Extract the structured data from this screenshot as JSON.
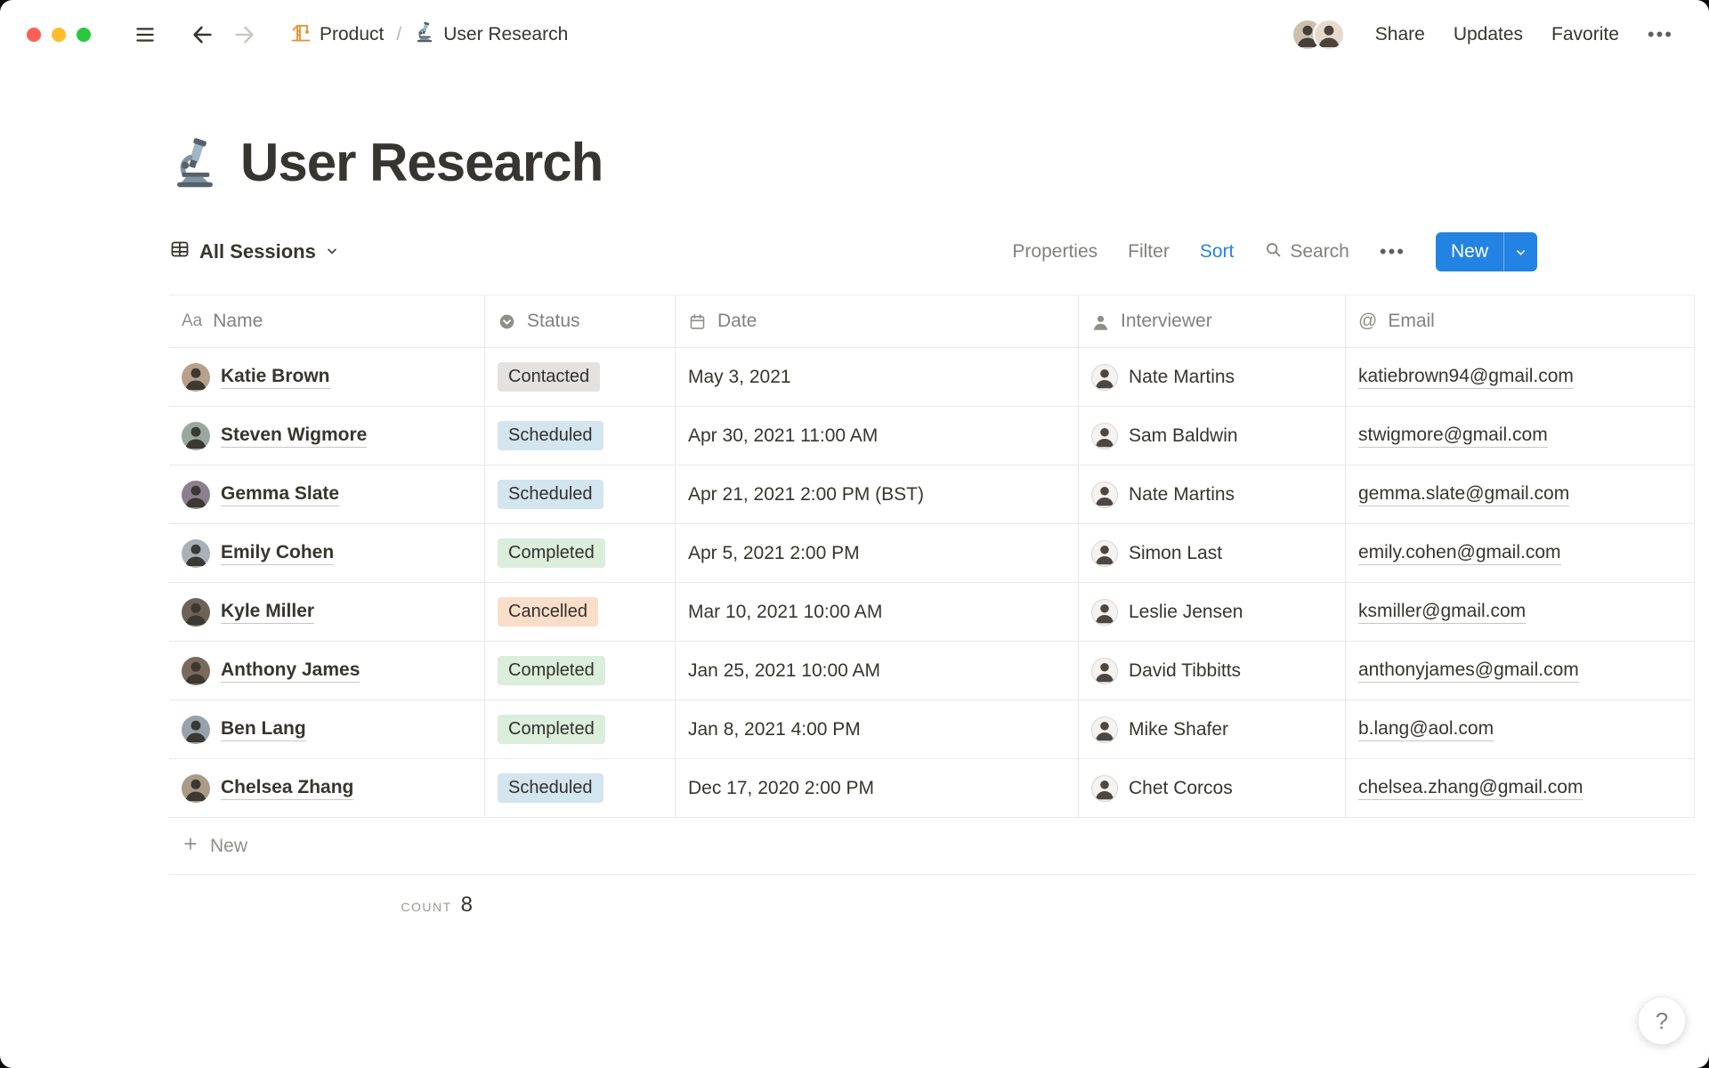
{
  "colors": {
    "accent": "#2383E2",
    "status_pill": {
      "gray": "#E3E2E0",
      "blue": "#D3E5EF",
      "green": "#DBEDDB",
      "orange": "#FADEC9"
    }
  },
  "titlebar": {
    "breadcrumb": {
      "product_label": "Product",
      "separator": "/",
      "page_label": "User Research"
    },
    "share_label": "Share",
    "updates_label": "Updates",
    "favorite_label": "Favorite",
    "more_label": "•••"
  },
  "page": {
    "title": "User Research"
  },
  "toolbar": {
    "view_label": "All Sessions",
    "properties_label": "Properties",
    "filter_label": "Filter",
    "sort_label": "Sort",
    "search_label": "Search",
    "more_label": "•••",
    "new_label": "New"
  },
  "table": {
    "columns": [
      {
        "label": "Name",
        "icon_glyph": "Aa"
      },
      {
        "label": "Status"
      },
      {
        "label": "Date"
      },
      {
        "label": "Interviewer"
      },
      {
        "label": "Email",
        "icon_glyph": "@"
      }
    ],
    "rows": [
      {
        "name": "Katie Brown",
        "status": "Contacted",
        "status_color": "gray",
        "date": "May 3, 2021",
        "interviewer": "Nate Martins",
        "email": "katiebrown94@gmail.com"
      },
      {
        "name": "Steven Wigmore",
        "status": "Scheduled",
        "status_color": "blue",
        "date": "Apr 30, 2021 11:00 AM",
        "interviewer": "Sam Baldwin",
        "email": "stwigmore@gmail.com"
      },
      {
        "name": "Gemma Slate",
        "status": "Scheduled",
        "status_color": "blue",
        "date": "Apr 21, 2021 2:00 PM (BST)",
        "interviewer": "Nate Martins",
        "email": "gemma.slate@gmail.com"
      },
      {
        "name": "Emily Cohen",
        "status": "Completed",
        "status_color": "green",
        "date": "Apr 5, 2021 2:00 PM",
        "interviewer": "Simon Last",
        "email": "emily.cohen@gmail.com"
      },
      {
        "name": "Kyle Miller",
        "status": "Cancelled",
        "status_color": "orange",
        "date": "Mar 10, 2021 10:00 AM",
        "interviewer": "Leslie Jensen",
        "email": "ksmiller@gmail.com"
      },
      {
        "name": "Anthony James",
        "status": "Completed",
        "status_color": "green",
        "date": "Jan 25, 2021 10:00 AM",
        "interviewer": "David Tibbitts",
        "email": "anthonyjames@gmail.com"
      },
      {
        "name": "Ben Lang",
        "status": "Completed",
        "status_color": "green",
        "date": "Jan 8, 2021 4:00 PM",
        "interviewer": "Mike Shafer",
        "email": "b.lang@aol.com"
      },
      {
        "name": "Chelsea Zhang",
        "status": "Scheduled",
        "status_color": "blue",
        "date": "Dec 17, 2020 2:00 PM",
        "interviewer": "Chet Corcos",
        "email": "chelsea.zhang@gmail.com"
      }
    ],
    "new_row_label": "New",
    "count_label": "COUNT",
    "count_value": "8"
  },
  "help_button_label": "?"
}
